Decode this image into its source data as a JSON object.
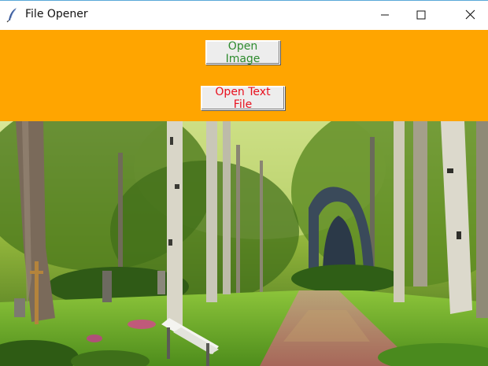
{
  "window": {
    "title": "File Opener",
    "icon": "feather-icon",
    "controls": [
      "minimize-icon",
      "maximize-icon",
      "close-icon"
    ]
  },
  "toolbar": {
    "background": "#ffa500",
    "open_image_label": "Open Image",
    "open_image_color": "#2e8b2e",
    "open_text_label": "Open Text File",
    "open_text_color": "#e8101e"
  },
  "image": {
    "subject": ""
  }
}
